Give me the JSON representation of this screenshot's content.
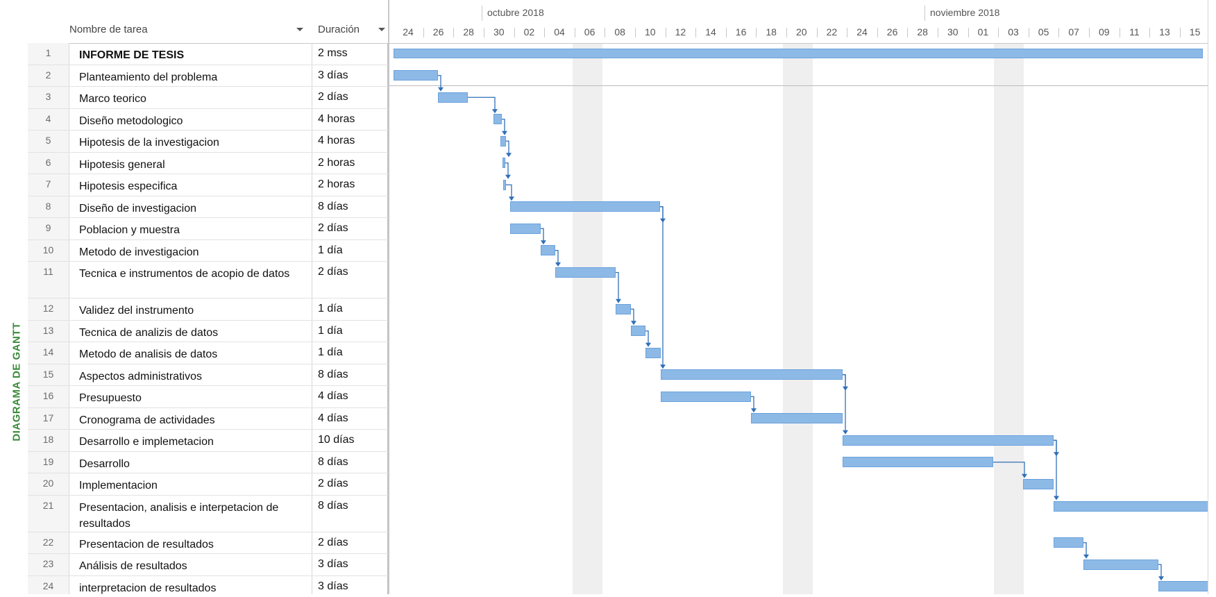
{
  "side_label": "DIAGRAMA DE GANTT",
  "grid": {
    "col_name_header": "Nombre de tarea",
    "col_dur_header": "Duración"
  },
  "timeline": {
    "months": [
      "octubre 2018",
      "noviembre 2018"
    ],
    "days": [
      "24",
      "26",
      "28",
      "30",
      "02",
      "04",
      "06",
      "08",
      "10",
      "12",
      "14",
      "16",
      "18",
      "20",
      "22",
      "24",
      "26",
      "28",
      "30",
      "01",
      "03",
      "05",
      "07",
      "09",
      "11",
      "13",
      "15"
    ]
  },
  "tasks": [
    {
      "id": "1",
      "name": "INFORME DE TESIS",
      "duration": "2 mss",
      "summary": true
    },
    {
      "id": "2",
      "name": "Planteamiento del problema",
      "duration": "3 días"
    },
    {
      "id": "3",
      "name": "Marco teorico",
      "duration": "2 días"
    },
    {
      "id": "4",
      "name": "Diseño metodologico",
      "duration": "4 horas"
    },
    {
      "id": "5",
      "name": "Hipotesis de la investigacion",
      "duration": "4 horas"
    },
    {
      "id": "6",
      "name": "Hipotesis general",
      "duration": "2 horas"
    },
    {
      "id": "7",
      "name": "Hipotesis especifica",
      "duration": "2 horas"
    },
    {
      "id": "8",
      "name": "Diseño de investigacion",
      "duration": "8 días"
    },
    {
      "id": "9",
      "name": "Poblacion y muestra",
      "duration": "2 días"
    },
    {
      "id": "10",
      "name": "Metodo de investigacion",
      "duration": "1 día"
    },
    {
      "id": "11",
      "name": "Tecnica e instrumentos de acopio de datos",
      "duration": "2 días"
    },
    {
      "id": "12",
      "name": "Validez del instrumento",
      "duration": "1 día"
    },
    {
      "id": "13",
      "name": "Tecnica de analizis de datos",
      "duration": "1 día"
    },
    {
      "id": "14",
      "name": "Metodo de analisis de datos",
      "duration": "1 día"
    },
    {
      "id": "15",
      "name": "Aspectos administrativos",
      "duration": "8 días"
    },
    {
      "id": "16",
      "name": "Presupuesto",
      "duration": "4 días"
    },
    {
      "id": "17",
      "name": "Cronograma de actividades",
      "duration": "4 días"
    },
    {
      "id": "18",
      "name": "Desarrollo e implemetacion",
      "duration": "10 días"
    },
    {
      "id": "19",
      "name": "Desarrollo",
      "duration": "8 días"
    },
    {
      "id": "20",
      "name": "Implementacion",
      "duration": "2 días"
    },
    {
      "id": "21",
      "name": "Presentacion, analisis e interpetacion de resultados",
      "duration": "8 días"
    },
    {
      "id": "22",
      "name": "Presentacion de resultados",
      "duration": "2 días"
    },
    {
      "id": "23",
      "name": "Análisis de resultados",
      "duration": "3 días"
    },
    {
      "id": "24",
      "name": "interpretacion de resultados",
      "duration": "3 días"
    }
  ],
  "colors": {
    "bar": "#8db9e6",
    "link": "#2f6fb8",
    "side_label": "#3a8a3a"
  }
}
